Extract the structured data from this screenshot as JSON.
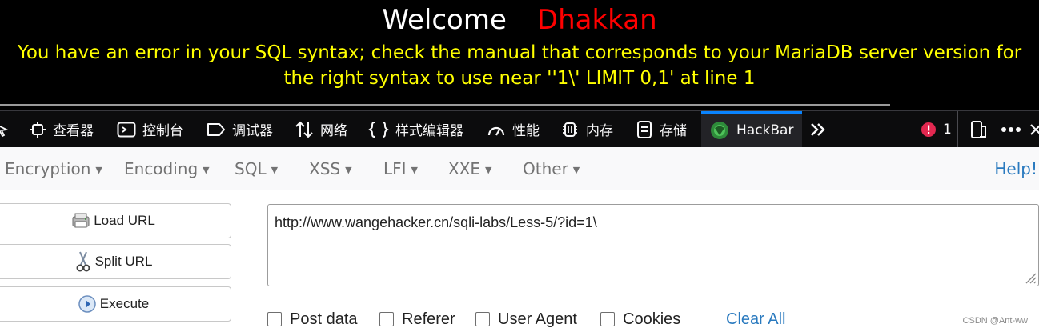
{
  "page": {
    "welcome": "Welcome",
    "username": "Dhakkan",
    "error_message": "You have an error in your SQL syntax; check the manual that corresponds to your MariaDB server version for the right syntax to use near ''1\\' LIMIT 0,1' at line 1"
  },
  "devtools": {
    "tabs": [
      {
        "label": "查看器",
        "icon": "inspector-icon"
      },
      {
        "label": "控制台",
        "icon": "console-icon"
      },
      {
        "label": "调试器",
        "icon": "debugger-icon"
      },
      {
        "label": "网络",
        "icon": "network-icon"
      },
      {
        "label": "样式编辑器",
        "icon": "style-editor-icon"
      },
      {
        "label": "性能",
        "icon": "performance-icon"
      },
      {
        "label": "内存",
        "icon": "memory-icon"
      },
      {
        "label": "存储",
        "icon": "storage-icon"
      },
      {
        "label": "HackBar",
        "icon": "hackbar-icon",
        "active": true
      }
    ],
    "error_count": "1",
    "colors": {
      "background": "#0c0c0d",
      "active_tab": "#0a84ff",
      "error": "#e22850"
    }
  },
  "hackbar": {
    "menu": [
      "Encryption",
      "Encoding",
      "SQL",
      "XSS",
      "LFI",
      "XXE",
      "Other"
    ],
    "help": "Help!",
    "buttons": {
      "load_url": "Load URL",
      "split_url": "Split URL",
      "execute": "Execute"
    },
    "url_value": "http://www.wangehacker.cn/sqli-labs/Less-5/?id=1\\",
    "options": [
      {
        "label": "Post data",
        "checked": false
      },
      {
        "label": "Referer",
        "checked": false
      },
      {
        "label": "User Agent",
        "checked": false
      },
      {
        "label": "Cookies",
        "checked": false
      }
    ],
    "clear_all": "Clear All"
  },
  "watermark": "CSDN @Ant-ww"
}
